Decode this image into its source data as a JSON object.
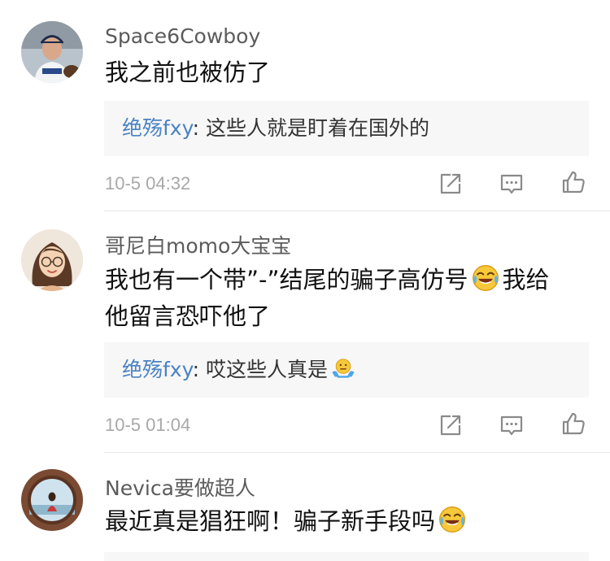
{
  "comments": [
    {
      "username": "Space6Cowboy",
      "content": "我之前也被仿了",
      "reply": {
        "author": "绝殇fxy",
        "separator": ": ",
        "text": "这些人就是盯着在国外的"
      },
      "timestamp": "10-5 04:32",
      "avatar_icon": "baseball-player-avatar"
    },
    {
      "username": "哥尼白momo大宝宝",
      "content_part1": "我也有一个带”-”结尾的骗子高仿号",
      "content_part2": "我给",
      "content_line2": "他留言恐吓他了",
      "content_emoji": "crying-laughing-emoji",
      "reply": {
        "author": "绝殇fxy",
        "separator": ": ",
        "text": "哎这些人真是",
        "emoji": "shrug-emoji"
      },
      "timestamp": "10-5 01:04",
      "avatar_icon": "cartoon-girl-avatar"
    },
    {
      "username": "Nevica要做超人",
      "content": "最近真是猖狂啊！骗子新手段吗",
      "content_emoji": "crying-laughing-emoji",
      "avatar_icon": "window-photo-avatar"
    }
  ],
  "colors": {
    "username": "#5b5b5b",
    "reply_author": "#4a82c4",
    "timestamp": "#a8a8a8",
    "reply_bg": "#f7f7f7",
    "icon": "#8a8a8a"
  }
}
